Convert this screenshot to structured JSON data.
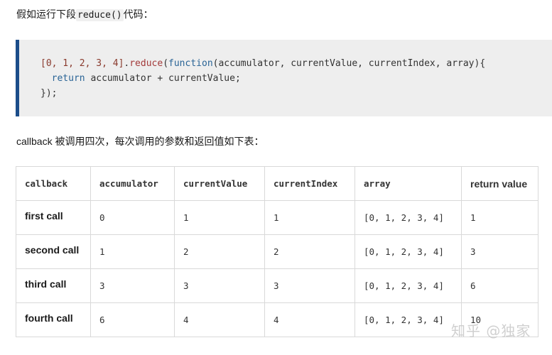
{
  "intro": {
    "prefix": "假如运行下段",
    "code": "reduce()",
    "suffix": "代码："
  },
  "code_block": {
    "line1": {
      "array": "[0, 1, 2, 3, 4]",
      "dot": ".",
      "method": "reduce",
      "open": "(",
      "keyword": "function",
      "params": "(accumulator, currentValue, currentIndex, array){"
    },
    "line2": {
      "indent": "  ",
      "keyword": "return",
      "expr": " accumulator + currentValue;"
    },
    "line3": "});"
  },
  "paragraph2": "callback 被调用四次，每次调用的参数和返回值如下表：",
  "table": {
    "headers": [
      "callback",
      "accumulator",
      "currentValue",
      "currentIndex",
      "array",
      "return value"
    ],
    "rows": [
      {
        "label": "first call",
        "accumulator": "0",
        "currentValue": "1",
        "currentIndex": "1",
        "array": "[0, 1, 2, 3, 4]",
        "return_value": "1"
      },
      {
        "label": "second call",
        "accumulator": "1",
        "currentValue": "2",
        "currentIndex": "2",
        "array": "[0, 1, 2, 3, 4]",
        "return_value": "3"
      },
      {
        "label": "third call",
        "accumulator": "3",
        "currentValue": "3",
        "currentIndex": "3",
        "array": "[0, 1, 2, 3, 4]",
        "return_value": "6"
      },
      {
        "label": "fourth call",
        "accumulator": "6",
        "currentValue": "4",
        "currentIndex": "4",
        "array": "[0, 1, 2, 3, 4]",
        "return_value": "10"
      }
    ]
  },
  "watermark": "知乎 @独家",
  "colors": {
    "code_border": "#1b4d8a",
    "code_background": "#eeeeee",
    "keyword": "#2a6496",
    "method": "#a33a3a"
  }
}
